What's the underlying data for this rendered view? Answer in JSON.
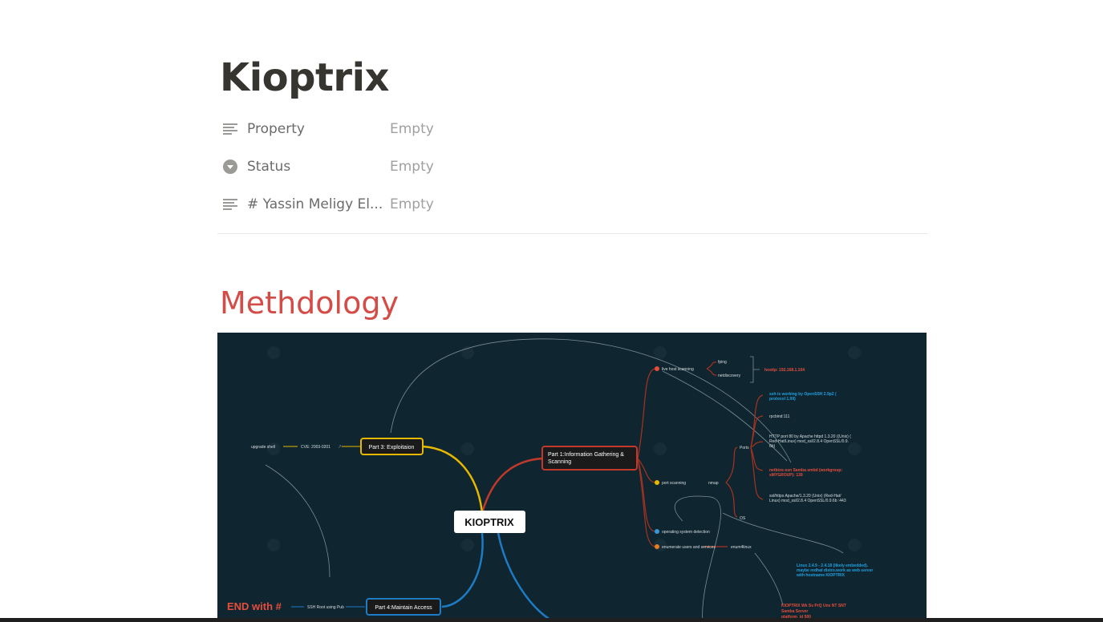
{
  "page": {
    "title": "Kioptrix",
    "properties": [
      {
        "name": "Property",
        "value": "Empty",
        "icon": "text-lines-icon"
      },
      {
        "name": "Status",
        "value": "Empty",
        "icon": "select-circle-icon"
      },
      {
        "name": "# Yassin Meligy El...",
        "value": "Empty",
        "icon": "text-lines-icon"
      }
    ],
    "heading": "Methdology"
  },
  "mindmap": {
    "center": "KIOPTRIX",
    "part1": "Part 1:Information Gathering & Scanning",
    "part1_line1": "Part 1:Information Gathering &",
    "part1_line2": "Scanning",
    "part3": "Part 3: Exploitaion",
    "part4": "Part 4:Maintain Access",
    "live_host": "live host scanning",
    "fping": "fping",
    "netdiscovery": "netdiscovery",
    "hostip": "hostip: 192.168.1.104",
    "ssh": "ssh is working by OpenSSH 2.9p2 (",
    "ssh2": "protocol 1.99)",
    "rpcbind": "rpcbind:111",
    "http1": "HTTP port 80 by Apache httpd 1.3.20 ((Unix) (",
    "http2": "Red-Hat/Linux) mod_ssl/2.8.4 OpenSSL/0.9.",
    "http3": "6b)",
    "netbios1": "netbios-ssn Samba smbd (workgroup:",
    "netbios2": "sMYGROUP): 139",
    "ssl1": "ssl/https Apache/1.3.20 (Unix) (Red-Hat/",
    "ssl2": "Linux) mod_ssl/2.8.4 OpenSSL/0.9.6b :443",
    "ports": "Ports",
    "os": "OS",
    "nmap": "nmap",
    "port_scanning": "port scanning",
    "os_detection": "operating system detection",
    "enumerate": "enumerate users and services",
    "enum4linux": "enum4linux",
    "linux1": "Linux 2.4.9 - 2.4.18 (likely embedded).",
    "linux2": "maybe redhat distro.work as web server",
    "linux3": "with hostname KIOPTRIX",
    "kioptrix_red1": "KIOPTRIX        Wk Sv PrQ Unx NT SNT",
    "kioptrix_red2": "Samba Server",
    "kioptrix_red3": "platform_id      500",
    "upgrade_shell": "upgrade shell",
    "cve": "CVE: 2003-0201",
    "ssh_root": "SSH Root using Pub",
    "end_with": "END with #"
  }
}
